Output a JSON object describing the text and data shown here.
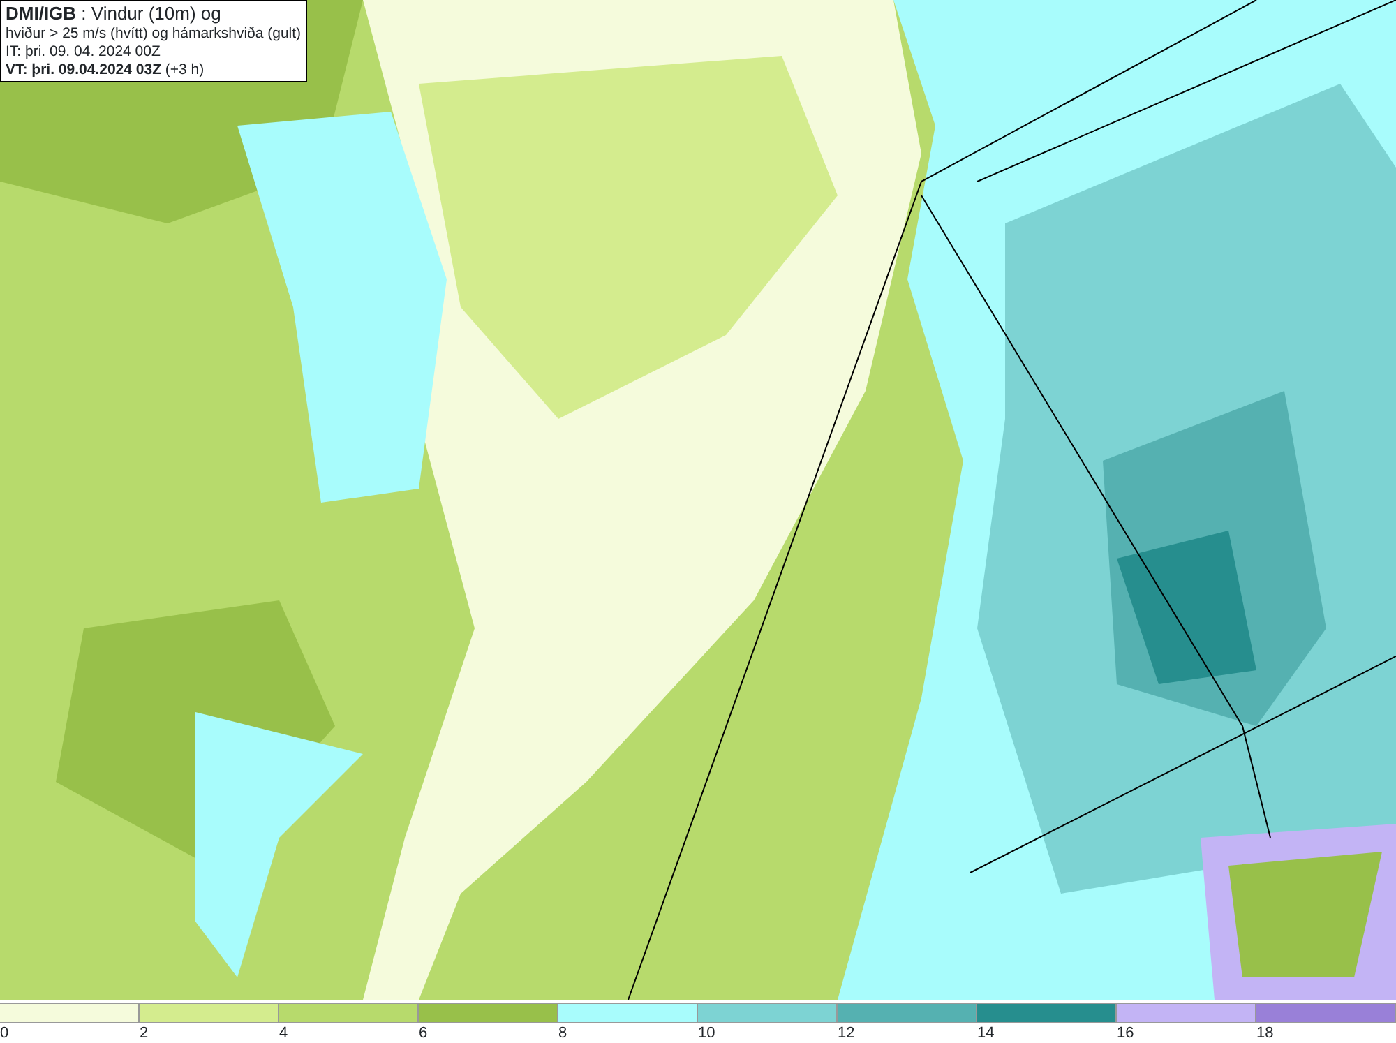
{
  "legend": {
    "lines": [
      "**DMI/IGB** : Vindur (10m) og",
      "hviður > 25 m/s (hvítt) og hámarkshviða (gult)",
      "IT: þri. 09. 04. 2024 00Z",
      "**VT: þri. 09.04.2024 03Z** (+3 h)"
    ]
  },
  "scale": {
    "segments": [
      {
        "color": "#f5fbdc",
        "label": "0"
      },
      {
        "color": "#d4ec8e",
        "label": "2"
      },
      {
        "color": "#b7da6c",
        "label": "4"
      },
      {
        "color": "#98c04a",
        "label": "6"
      },
      {
        "color": "#a8fcfc",
        "label": "8"
      },
      {
        "color": "#7dd3d3",
        "label": "10"
      },
      {
        "color": "#55b1b1",
        "label": "12"
      },
      {
        "color": "#268e8e",
        "label": "14"
      },
      {
        "color": "#c3b4f5",
        "label": "16"
      },
      {
        "color": "#9980d8",
        "label": "18"
      }
    ]
  }
}
